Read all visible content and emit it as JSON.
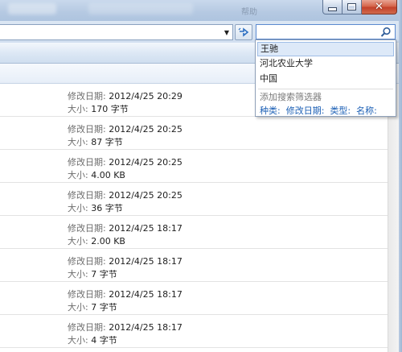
{
  "window": {
    "ghost_title": "帮助"
  },
  "search": {
    "value": "",
    "suggestions": [
      "王驰",
      "河北农业大学",
      "中国"
    ],
    "filter_title": "添加搜索筛选器",
    "filters": [
      "种类:",
      "修改日期:",
      "类型:",
      "名称:"
    ]
  },
  "files": [
    {
      "date_label": "修改日期:",
      "date": "2012/4/25 20:29",
      "size_label": "大小:",
      "size": "170 字节"
    },
    {
      "date_label": "修改日期:",
      "date": "2012/4/25 20:25",
      "size_label": "大小:",
      "size": "87 字节"
    },
    {
      "date_label": "修改日期:",
      "date": "2012/4/25 20:25",
      "size_label": "大小:",
      "size": "4.00 KB"
    },
    {
      "date_label": "修改日期:",
      "date": "2012/4/25 20:25",
      "size_label": "大小:",
      "size": "36 字节"
    },
    {
      "date_label": "修改日期:",
      "date": "2012/4/25 18:17",
      "size_label": "大小:",
      "size": "2.00 KB"
    },
    {
      "date_label": "修改日期:",
      "date": "2012/4/25 18:17",
      "size_label": "大小:",
      "size": "7 字节"
    },
    {
      "date_label": "修改日期:",
      "date": "2012/4/25 18:17",
      "size_label": "大小:",
      "size": "7 字节"
    },
    {
      "date_label": "修改日期:",
      "date": "2012/4/25 18:17",
      "size_label": "大小:",
      "size": "4 字节"
    }
  ],
  "icons": {
    "minimize": "minimize-icon",
    "maximize": "maximize-icon",
    "close": "close-icon",
    "refresh": "refresh-icon",
    "search": "search-icon",
    "dropdown": "chevron-down-icon"
  },
  "colors": {
    "link": "#1b5fb5",
    "selection": "#dde9f8",
    "close_button": "#c3412a"
  }
}
